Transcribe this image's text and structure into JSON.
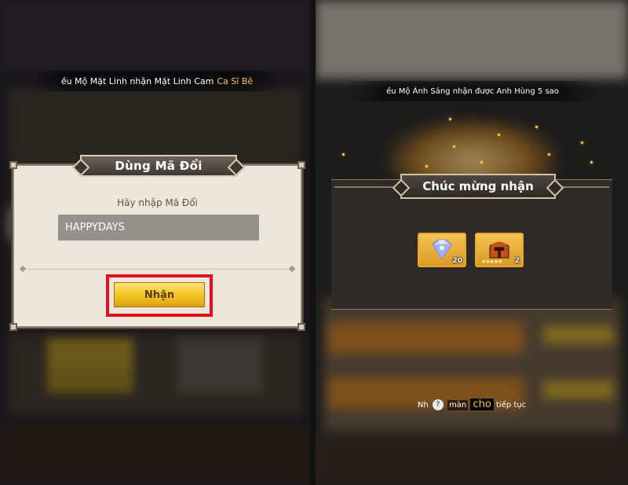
{
  "left": {
    "banner": {
      "text": "ều Mộ Mặt Linh nhận Mặt Linh Cam",
      "highlight": "Ca Sĩ Bê"
    },
    "dialog": {
      "title": "Dùng Mã Đổi",
      "prompt": "Hãy nhập Mã Đổi",
      "code_value": "HAPPYDAYS",
      "redeem_label": "Nhận"
    }
  },
  "right": {
    "banner": {
      "text": "ều Mộ Ánh Sáng nhận được Anh Hùng 5 sao"
    },
    "reward": {
      "title": "Chúc mừng nhận",
      "items": [
        {
          "icon": "diamond-gem-icon",
          "qty": "20"
        },
        {
          "icon": "hero-helmet-icon",
          "qty": "2",
          "stars": "★★★★★"
        }
      ]
    },
    "continue": {
      "prefix": "Nh",
      "badge": "?",
      "middle": "màn",
      "overlay": "cho",
      "suffix": "tiếp tục"
    }
  },
  "colors": {
    "accent_gold": "#f4c21f",
    "highlight_red": "#e3121a",
    "banner_highlight": "#ffc83c"
  }
}
